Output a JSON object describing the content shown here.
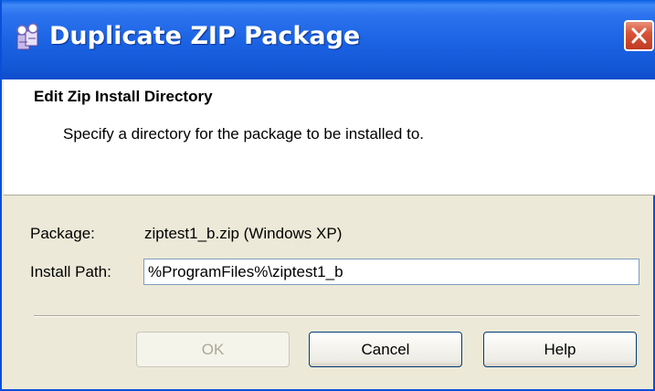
{
  "window": {
    "title": "Duplicate ZIP Package",
    "icon": "package-icon",
    "close_icon": "close-icon"
  },
  "header": {
    "title": "Edit Zip Install Directory",
    "description": "Specify a directory for the package to be installed to."
  },
  "form": {
    "package_label": "Package:",
    "package_value": "ziptest1_b.zip (Windows XP)",
    "install_path_label": "Install Path:",
    "install_path_value": "%ProgramFiles%\\ziptest1_b"
  },
  "buttons": {
    "ok": "OK",
    "ok_enabled": false,
    "cancel": "Cancel",
    "help": "Help"
  },
  "colors": {
    "titlebar": "#0b5fe6",
    "close_button": "#d8553a",
    "dialog_background": "#ece9d8"
  }
}
